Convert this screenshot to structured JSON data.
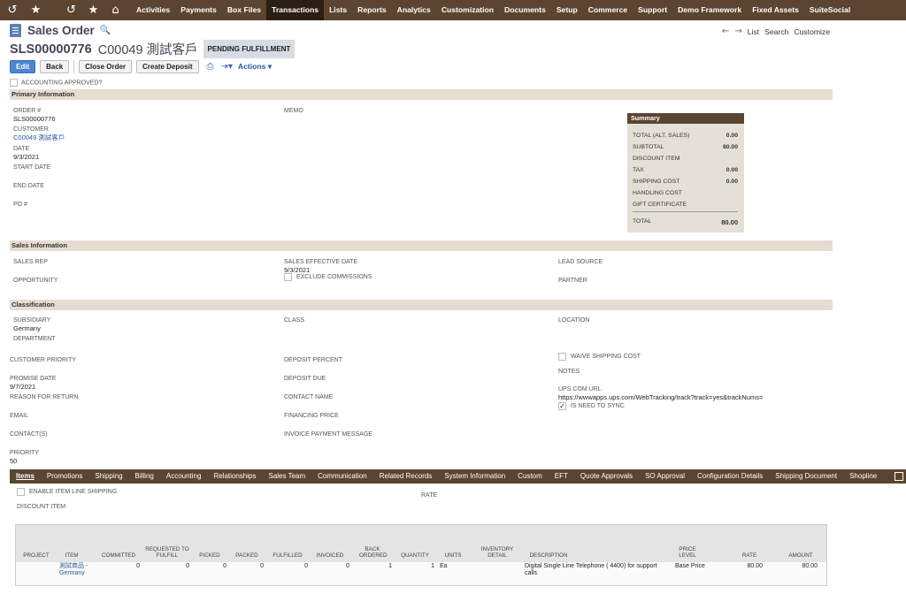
{
  "topbar": {
    "nav": [
      "Activities",
      "Payments",
      "Box Files",
      "Transactions",
      "Lists",
      "Reports",
      "Analytics",
      "Customization",
      "Documents",
      "Setup",
      "Commerce",
      "Support",
      "Demo Framework",
      "Fixed Assets",
      "SuiteSocial"
    ],
    "active": "Transactions",
    "icons": [
      "recent-icon",
      "star-icon",
      "history-icon",
      "favorites-icon",
      "home-icon"
    ]
  },
  "header": {
    "title": "Sales Order",
    "order_number": "SLS00000776",
    "customer_display": "C00049 測試客戶",
    "status": "PENDING FULFILLMENT",
    "nav": {
      "list": "List",
      "search": "Search",
      "customize": "Customize"
    }
  },
  "toolbar": {
    "edit": "Edit",
    "back": "Back",
    "close_order": "Close Order",
    "create_deposit": "Create Deposit",
    "actions": "Actions"
  },
  "accounting_approved": "ACCOUNTING APPROVED?",
  "primary": {
    "section": "Primary Information",
    "order_label": "ORDER #",
    "order_value": "SLS00000776",
    "customer_label": "CUSTOMER",
    "customer_value": "C00049 測試客戶",
    "date_label": "DATE",
    "date_value": "9/3/2021",
    "start_date_label": "START DATE",
    "end_date_label": "END DATE",
    "po_label": "PO #",
    "memo_label": "MEMO"
  },
  "summary": {
    "title": "Summary",
    "rows": [
      {
        "label": "TOTAL (ALT. SALES)",
        "value": "0.00"
      },
      {
        "label": "SUBTOTAL",
        "value": "80.00"
      },
      {
        "label": "DISCOUNT ITEM",
        "value": ""
      },
      {
        "label": "TAX",
        "value": "0.00"
      },
      {
        "label": "SHIPPING COST",
        "value": "0.00"
      },
      {
        "label": "HANDLING COST",
        "value": ""
      },
      {
        "label": "GIFT CERTIFICATE",
        "value": ""
      }
    ],
    "total_label": "TOTAL",
    "total_value": "80.00"
  },
  "sales": {
    "section": "Sales Information",
    "sales_rep": "SALES REP",
    "opportunity": "OPPORTUNITY",
    "eff_date_label": "SALES EFFECTIVE DATE",
    "eff_date_value": "9/3/2021",
    "exclude_commissions": "EXCLUDE COMMISSIONS",
    "lead_source": "LEAD SOURCE",
    "partner": "PARTNER"
  },
  "classification": {
    "section": "Classification",
    "subsidiary_label": "SUBSIDIARY",
    "subsidiary_value": "Germany",
    "department": "DEPARTMENT",
    "class": "CLASS",
    "location": "LOCATION"
  },
  "other": {
    "customer_priority": "CUSTOMER PRIORITY",
    "promise_date_label": "PROMISE DATE",
    "promise_date_value": "9/7/2021",
    "reason_for_return": "REASON FOR RETURN",
    "email": "EMAIL",
    "contacts": "CONTACT(S)",
    "priority_label": "PRIORITY",
    "priority_value": "50",
    "deposit_percent": "DEPOSIT PERCENT",
    "deposit_due": "DEPOSIT DUE",
    "contact_name": "CONTACT NAME",
    "financing_price": "FINANCING PRICE",
    "invoice_payment_message": "INVOICE PAYMENT MESSAGE",
    "waive_shipping_cost": "WAIVE SHIPPING COST",
    "notes": "NOTES",
    "ups_url_label": "UPS.COM URL",
    "ups_url_value": "https://wwwapps.ups.com/WebTracking/track?track=yes&trackNums=",
    "is_need_to_sync": "IS NEED TO SYNC"
  },
  "tabs": [
    "Items",
    "Promotions",
    "Shipping",
    "Billing",
    "Accounting",
    "Relationships",
    "Sales Team",
    "Communication",
    "Related Records",
    "System Information",
    "Custom",
    "EFT",
    "Quote Approvals",
    "SO Approval",
    "Configuration Details",
    "Shipping Document",
    "Shopline"
  ],
  "items": {
    "enable_line_shipping": "ENABLE ITEM LINE SHIPPING",
    "rate": "RATE",
    "discount_item": "DISCOUNT ITEM",
    "columns": [
      "PROJECT",
      "ITEM",
      "COMMITTED",
      "REQUESTED TO FULFILL",
      "PICKED",
      "PACKED",
      "FULFILLED",
      "INVOICED",
      "BACK ORDERED",
      "QUANTITY",
      "UNITS",
      "INVENTORY DETAIL",
      "DESCRIPTION",
      "PRICE LEVEL",
      "RATE",
      "AMOUNT"
    ],
    "row": {
      "project": "",
      "item_line1": "測試商品 -",
      "item_line2": "Germany",
      "committed": "0",
      "requested": "0",
      "picked": "0",
      "packed": "0",
      "fulfilled": "0",
      "invoiced": "0",
      "back_ordered": "1",
      "quantity": "1",
      "units": "Ea",
      "inventory_detail": "",
      "description": "Digital Single Line Telephone ( 4400) for support calls",
      "price_level": "Base Price",
      "rate": "80.00",
      "amount": "80.00"
    }
  }
}
